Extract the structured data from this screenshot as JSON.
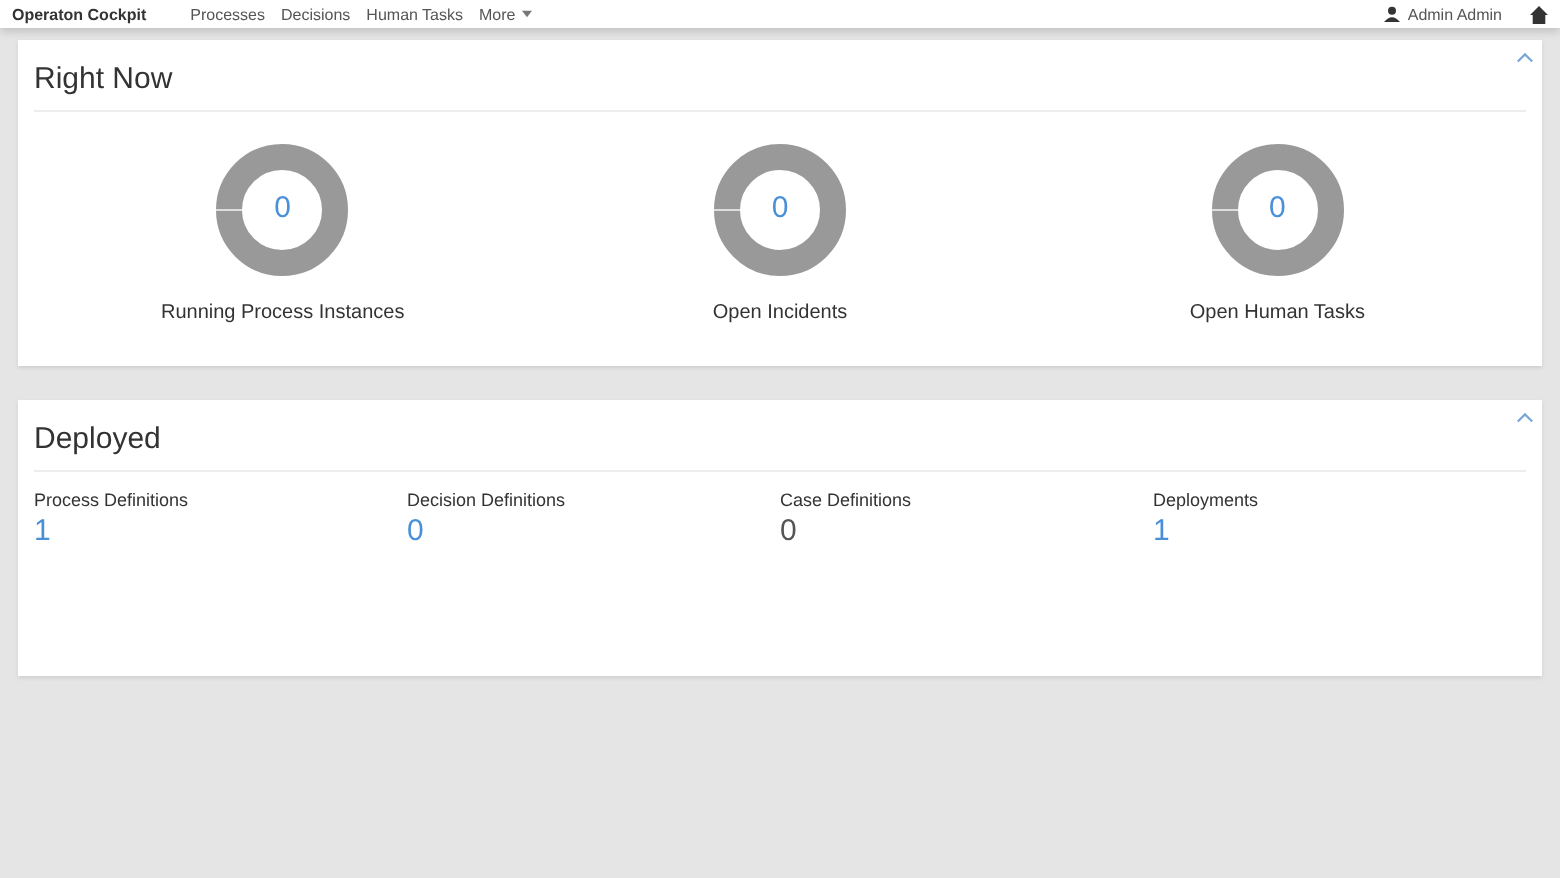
{
  "header": {
    "brand": "Operaton Cockpit",
    "nav": [
      {
        "label": "Processes"
      },
      {
        "label": "Decisions"
      },
      {
        "label": "Human Tasks"
      },
      {
        "label": "More",
        "dropdown": true
      }
    ],
    "user": "Admin Admin"
  },
  "right_now": {
    "title": "Right Now",
    "expanded": true,
    "items": [
      {
        "value": "0",
        "label": "Running Process Instances"
      },
      {
        "value": "0",
        "label": "Open Incidents"
      },
      {
        "value": "0",
        "label": "Open Human Tasks"
      }
    ]
  },
  "deployed": {
    "title": "Deployed",
    "expanded": true,
    "items": [
      {
        "label": "Process Definitions",
        "value": "1",
        "kind": "link"
      },
      {
        "label": "Decision Definitions",
        "value": "0",
        "kind": "link"
      },
      {
        "label": "Case Definitions",
        "value": "0",
        "kind": "plain"
      },
      {
        "label": "Deployments",
        "value": "1",
        "kind": "link"
      }
    ]
  }
}
